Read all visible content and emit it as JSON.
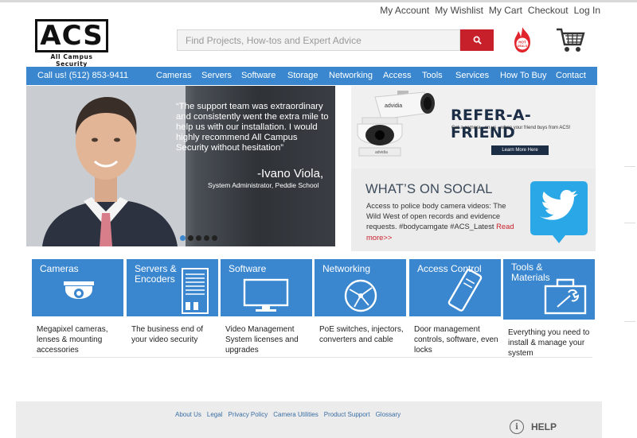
{
  "header": {
    "top_links": [
      "My Account",
      "My Wishlist",
      "My Cart",
      "Checkout",
      "Log In"
    ],
    "logo_text": "ACS",
    "logo_subtitle": "All Campus Security",
    "search_placeholder": "Find Projects, How-tos and Expert Advice",
    "search_icon": "search-icon",
    "hot_deals_label": "HOT DEALS",
    "cart_icon": "cart-icon"
  },
  "nav": {
    "phone": "Call us! (512) 853-9411",
    "items": [
      "Cameras",
      "Servers",
      "Software",
      "Storage",
      "Networking",
      "Access",
      "Tools",
      "Services",
      "How To Buy",
      "Contact"
    ]
  },
  "hero": {
    "quote": "“The support team was extraordinary and consistently went the extra mile to help us with our installation. I would highly recommend All Campus Security without hesitation”",
    "name": "-Ivano Viola,",
    "title": "System Administrator, Peddie School",
    "slides": 5,
    "active_slide": 1
  },
  "promo": {
    "brand": "advidia",
    "title": "REFER-A-FRIEND",
    "subtitle": "Get a camera - on us - when your friend buys from ACS!",
    "button": "Learn More Here"
  },
  "social": {
    "title": "WHAT’S ON SOCIAL",
    "body": "Access to police body camera videos: The Wild West of open records and evidence requests. #bodycamgate #ACS_Latest",
    "read_more": "Read more>>"
  },
  "categories": [
    {
      "title": "Cameras",
      "icon": "dome-camera-icon",
      "desc": "Megapixel cameras, lenses & mounting accessories"
    },
    {
      "title": "Servers & Encoders",
      "icon": "server-icon",
      "desc": "The business end of your video security"
    },
    {
      "title": "Software",
      "icon": "monitor-icon",
      "desc": "Video Management System licenses and upgrades"
    },
    {
      "title": "Networking",
      "icon": "network-globe-icon",
      "desc": "PoE switches, injectors, converters and cable"
    },
    {
      "title": "Access Control",
      "icon": "access-card-icon",
      "desc": "Door management controls, software, even locks"
    },
    {
      "title": "Tools & Materials",
      "icon": "toolbox-icon",
      "desc": "Everything you need to install & manage your system"
    }
  ],
  "footer": {
    "links": [
      "About Us",
      "Legal",
      "Privacy Policy",
      "Camera Utilities",
      "Product Support",
      "Glossary"
    ],
    "help": "HELP",
    "help_icon": "info-icon"
  },
  "colors": {
    "nav_blue": "#3a87cf",
    "search_red": "#c8202a",
    "promo_navy": "#1c2e46"
  }
}
